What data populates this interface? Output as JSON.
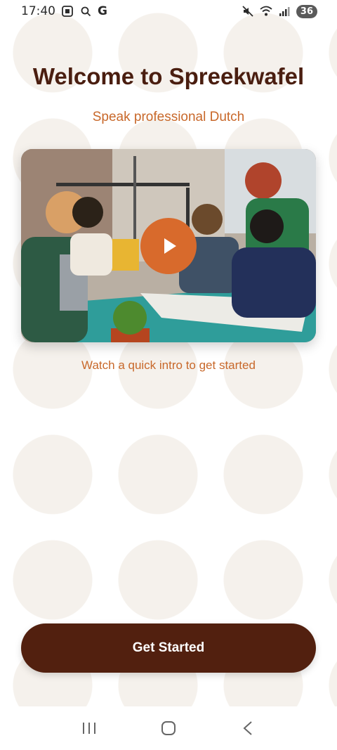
{
  "status_bar": {
    "time": "17:40",
    "g_letter": "G",
    "battery": "36"
  },
  "header": {
    "title": "Welcome to Spreekwafel",
    "subtitle": "Speak professional Dutch"
  },
  "video": {
    "caption": "Watch a quick intro to get started",
    "play_icon": "play-icon"
  },
  "actions": {
    "get_started_label": "Get Started"
  },
  "nav": {
    "icons": [
      "recent-apps-icon",
      "home-icon",
      "back-icon"
    ]
  },
  "colors": {
    "title": "#4a1e10",
    "accent": "#c8682a",
    "play_button": "#d86a2c",
    "button_bg": "#52200f",
    "background_dots": "#f5f1ec"
  }
}
